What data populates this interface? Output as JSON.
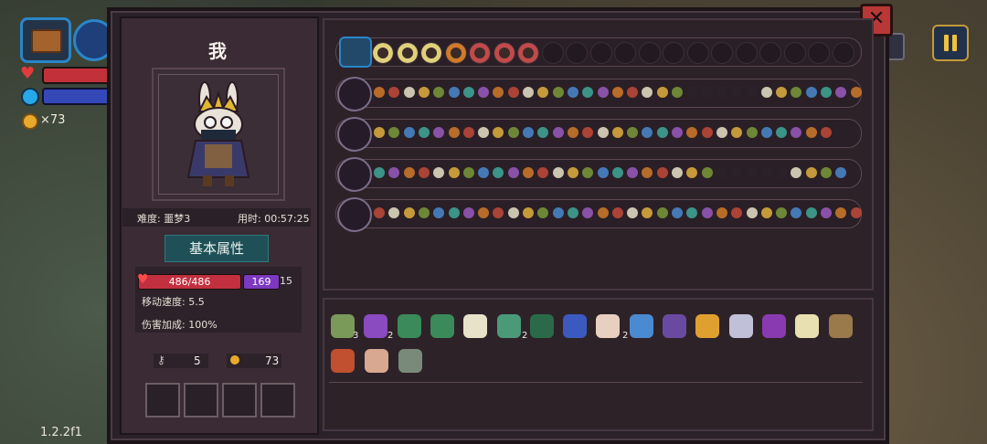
{
  "hud": {
    "coins_label": "×73",
    "version": "1.2.2f1"
  },
  "character": {
    "name": "我",
    "difficulty": "难度: 噩梦3",
    "time": "用时: 00:57:25",
    "attr_tab": "基本属性",
    "hp": "486/486",
    "mp": "169",
    "mp_extra": "15",
    "move_speed": "移动速度: 5.5",
    "damage_bonus": "伤害加成: 100%",
    "keys": "5",
    "coins": "73"
  },
  "items": {
    "counts": [
      "3",
      "2",
      "2",
      "2"
    ]
  },
  "colors": {
    "accent": "#2a86c8",
    "hp": "#c23040",
    "mp": "#7c38c0",
    "panel": "#2e2229",
    "close": "#b73836"
  }
}
